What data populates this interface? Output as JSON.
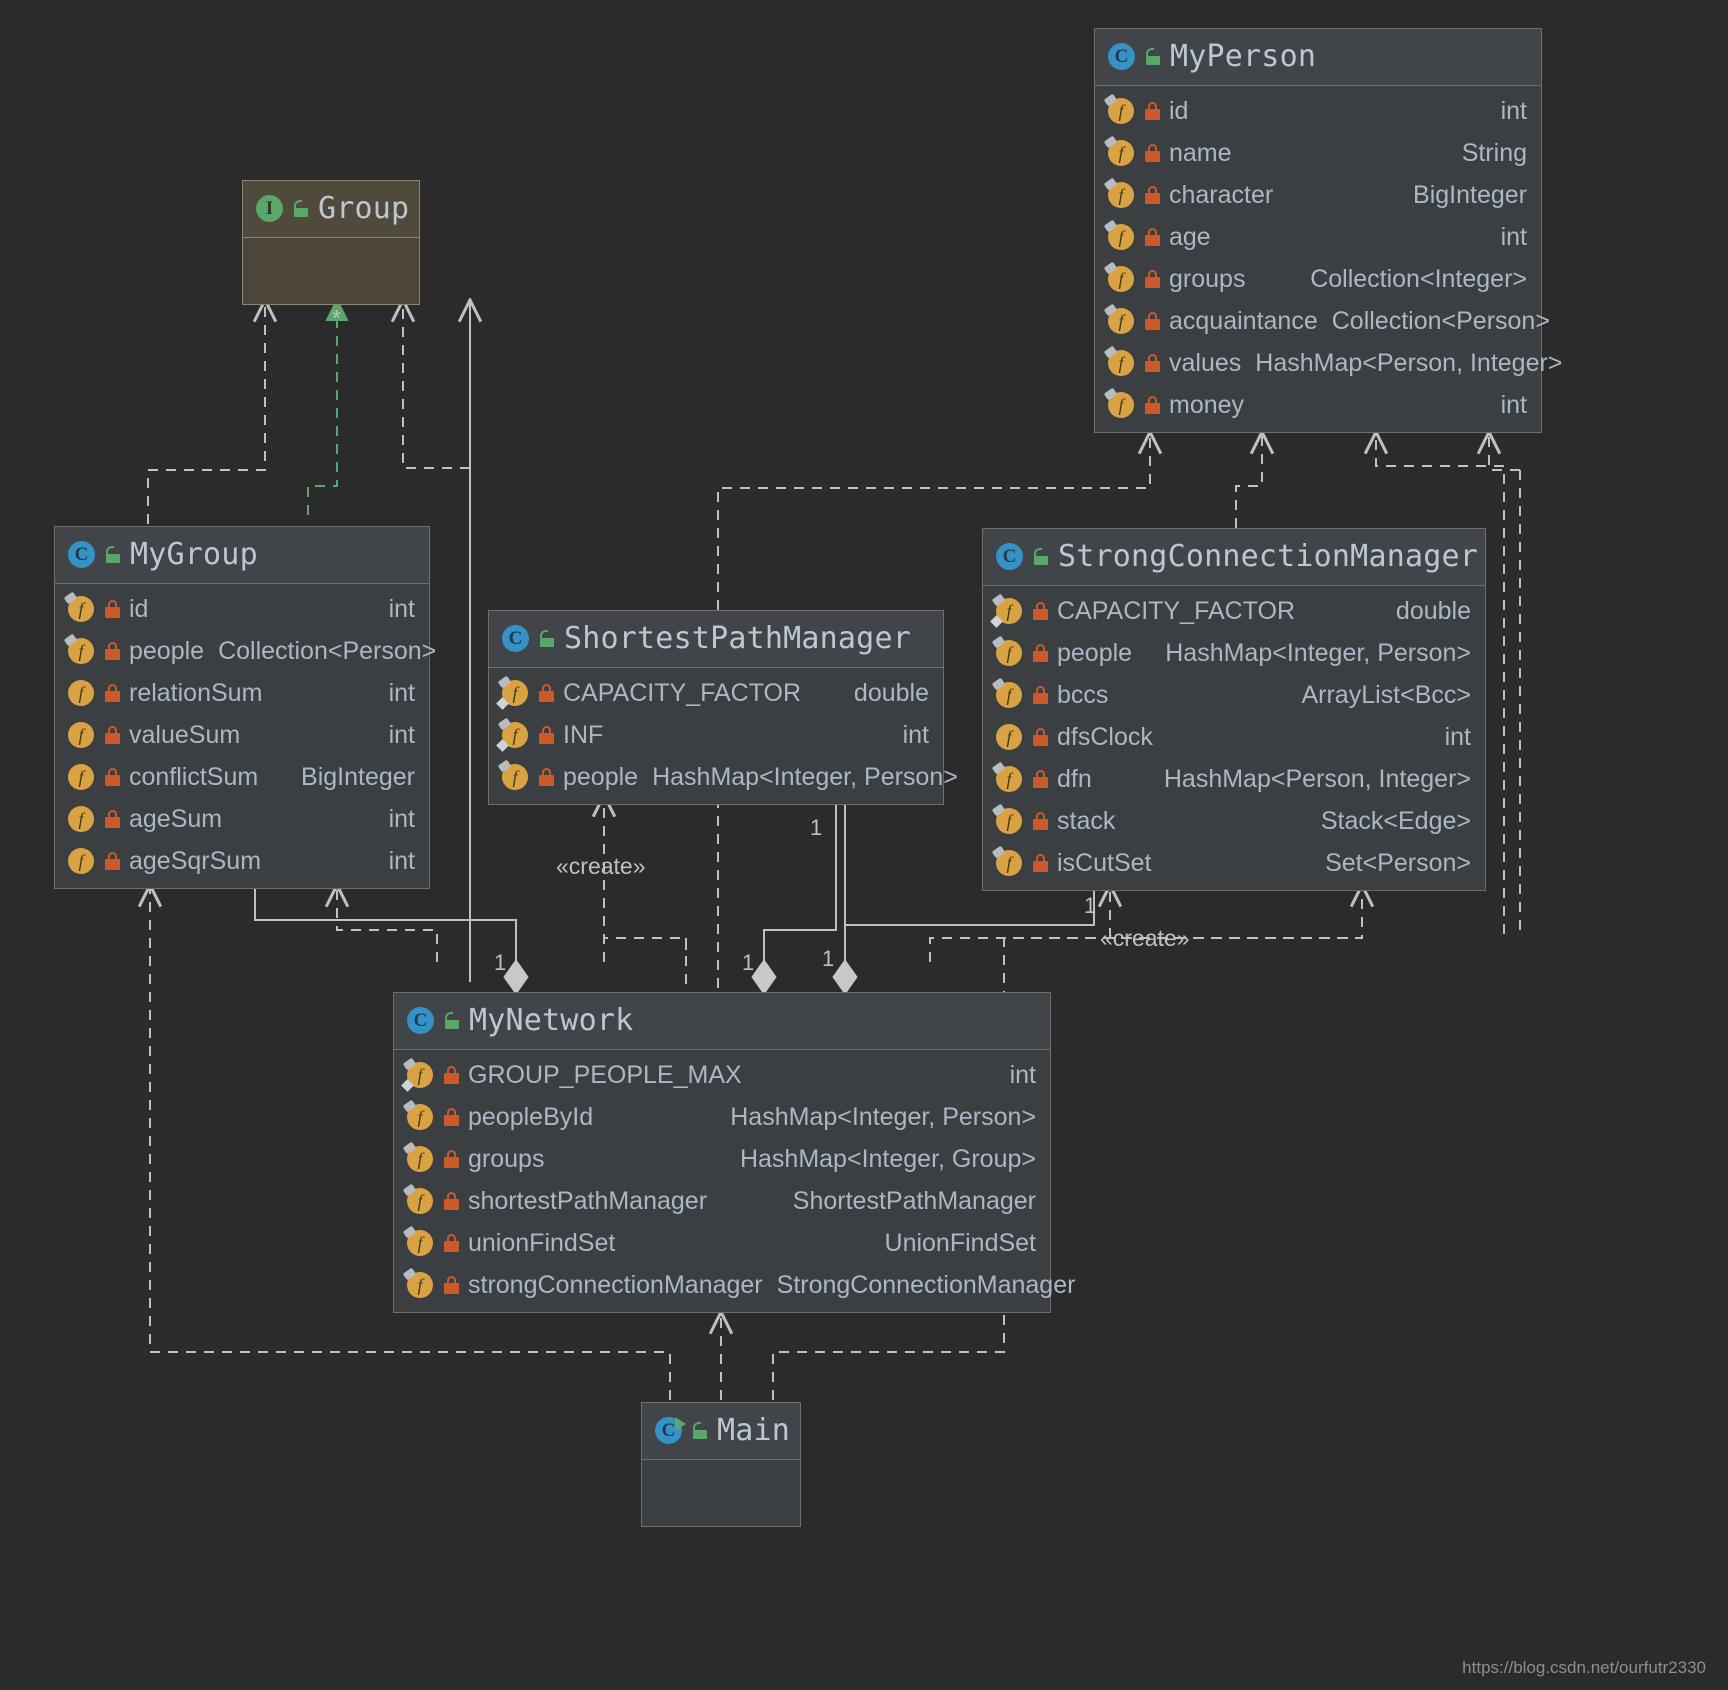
{
  "diagram": {
    "kind": "uml-class-diagram",
    "background": "#2b2b2b",
    "watermark": "https://blog.csdn.net/ourfutr2330"
  },
  "colors": {
    "node_bg": "#3c3f41",
    "node_header_bg": "#41454a",
    "node_border": "#6e6e6e",
    "interface_bg": "#4b4639",
    "class_icon": "#3592c4",
    "interface_icon": "#59a869",
    "field_icon": "#d9a343",
    "lock_icon": "#cc5a28",
    "unlock_icon": "#59a869",
    "text": "#a9b7c6",
    "edge": "#c0c0c0",
    "inherit_edge": "#59a869"
  },
  "nodes": {
    "my_person": {
      "name": "MyPerson",
      "stereotype": "class",
      "visibility": "public",
      "fields": [
        {
          "name": "id",
          "type": "int",
          "modifier": "final",
          "access": "private"
        },
        {
          "name": "name",
          "type": "String",
          "modifier": "final",
          "access": "private"
        },
        {
          "name": "character",
          "type": "BigInteger",
          "modifier": "final",
          "access": "private"
        },
        {
          "name": "age",
          "type": "int",
          "modifier": "final",
          "access": "private"
        },
        {
          "name": "groups",
          "type": "Collection<Integer>",
          "modifier": "final",
          "access": "private"
        },
        {
          "name": "acquaintance",
          "type": "Collection<Person>",
          "modifier": "final",
          "access": "private"
        },
        {
          "name": "values",
          "type": "HashMap<Person, Integer>",
          "modifier": "final",
          "access": "private"
        },
        {
          "name": "money",
          "type": "int",
          "modifier": "final",
          "access": "private"
        }
      ]
    },
    "group": {
      "name": "Group",
      "stereotype": "interface",
      "visibility": "public",
      "fields": []
    },
    "my_group": {
      "name": "MyGroup",
      "stereotype": "class",
      "visibility": "public",
      "fields": [
        {
          "name": "id",
          "type": "int",
          "modifier": "final",
          "access": "private"
        },
        {
          "name": "people",
          "type": "Collection<Person>",
          "modifier": "final",
          "access": "private"
        },
        {
          "name": "relationSum",
          "type": "int",
          "modifier": "none",
          "access": "private"
        },
        {
          "name": "valueSum",
          "type": "int",
          "modifier": "none",
          "access": "private"
        },
        {
          "name": "conflictSum",
          "type": "BigInteger",
          "modifier": "none",
          "access": "private"
        },
        {
          "name": "ageSum",
          "type": "int",
          "modifier": "none",
          "access": "private"
        },
        {
          "name": "ageSqrSum",
          "type": "int",
          "modifier": "none",
          "access": "private"
        }
      ]
    },
    "shortest_path_manager": {
      "name": "ShortestPathManager",
      "stereotype": "class",
      "visibility": "public",
      "fields": [
        {
          "name": "CAPACITY_FACTOR",
          "type": "double",
          "modifier": "static-final",
          "access": "private"
        },
        {
          "name": "INF",
          "type": "int",
          "modifier": "static-final",
          "access": "private"
        },
        {
          "name": "people",
          "type": "HashMap<Integer, Person>",
          "modifier": "final",
          "access": "private"
        }
      ]
    },
    "strong_connection_manager": {
      "name": "StrongConnectionManager",
      "stereotype": "class",
      "visibility": "public",
      "fields": [
        {
          "name": "CAPACITY_FACTOR",
          "type": "double",
          "modifier": "static-final",
          "access": "private"
        },
        {
          "name": "people",
          "type": "HashMap<Integer, Person>",
          "modifier": "final",
          "access": "private"
        },
        {
          "name": "bccs",
          "type": "ArrayList<Bcc>",
          "modifier": "final",
          "access": "private"
        },
        {
          "name": "dfsClock",
          "type": "int",
          "modifier": "none",
          "access": "private"
        },
        {
          "name": "dfn",
          "type": "HashMap<Person, Integer>",
          "modifier": "final",
          "access": "private"
        },
        {
          "name": "stack",
          "type": "Stack<Edge>",
          "modifier": "final",
          "access": "private"
        },
        {
          "name": "isCutSet",
          "type": "Set<Person>",
          "modifier": "final",
          "access": "private"
        }
      ]
    },
    "my_network": {
      "name": "MyNetwork",
      "stereotype": "class",
      "visibility": "public",
      "fields": [
        {
          "name": "GROUP_PEOPLE_MAX",
          "type": "int",
          "modifier": "static-final",
          "access": "private"
        },
        {
          "name": "peopleById",
          "type": "HashMap<Integer, Person>",
          "modifier": "final",
          "access": "private"
        },
        {
          "name": "groups",
          "type": "HashMap<Integer, Group>",
          "modifier": "final",
          "access": "private"
        },
        {
          "name": "shortestPathManager",
          "type": "ShortestPathManager",
          "modifier": "final",
          "access": "private"
        },
        {
          "name": "unionFindSet",
          "type": "UnionFindSet",
          "modifier": "final",
          "access": "private"
        },
        {
          "name": "strongConnectionManager",
          "type": "StrongConnectionManager",
          "modifier": "final",
          "access": "private"
        }
      ]
    },
    "main": {
      "name": "Main",
      "stereotype": "class",
      "visibility": "public",
      "runnable": true,
      "fields": []
    }
  },
  "edge_labels": [
    {
      "id": "group-star",
      "text": "*"
    },
    {
      "id": "create-spm",
      "text": "«create»"
    },
    {
      "id": "create-scm",
      "text": "«create»"
    },
    {
      "id": "mult-mygroup",
      "text": "1"
    },
    {
      "id": "mult-spm-left",
      "text": "1"
    },
    {
      "id": "mult-spm-right",
      "text": "1"
    },
    {
      "id": "mult-spm-top",
      "text": "1"
    },
    {
      "id": "mult-scm",
      "text": "1"
    }
  ],
  "icon_names": {
    "class": "class-icon",
    "interface": "interface-icon",
    "field": "field-icon",
    "lock": "lock-icon",
    "unlock": "unlock-icon",
    "run": "run-icon"
  }
}
